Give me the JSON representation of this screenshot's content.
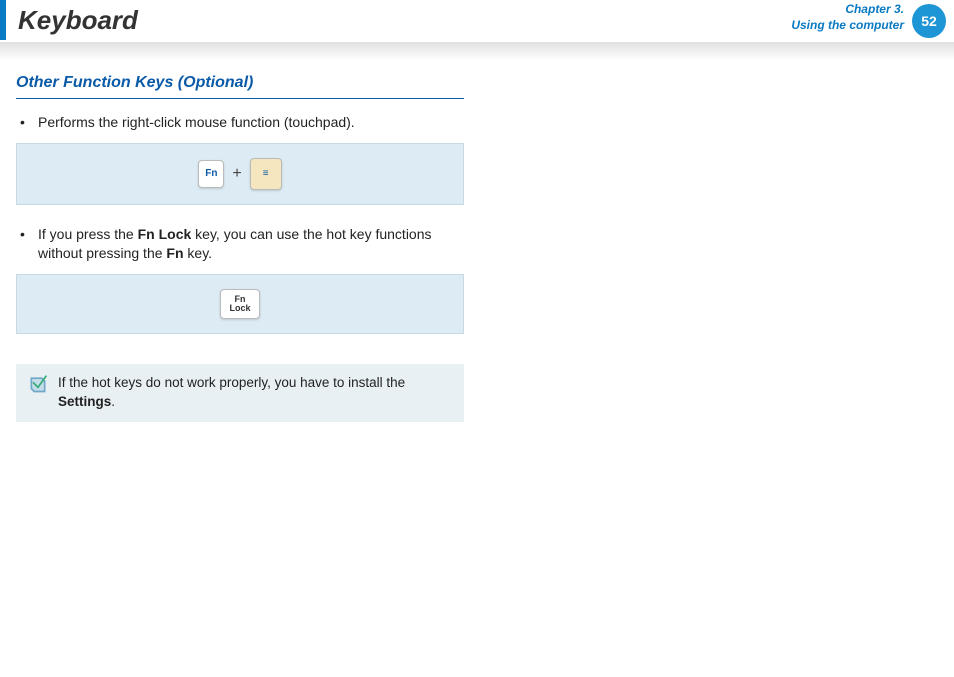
{
  "header": {
    "title": "Keyboard",
    "chapter_line1": "Chapter 3.",
    "chapter_line2": "Using the computer",
    "page_number": "52"
  },
  "section": {
    "heading": "Other Function Keys (Optional)",
    "bullet1": "Performs the right-click mouse function (touchpad).",
    "bullet2_pre": "If you press the ",
    "bullet2_b1": "Fn Lock",
    "bullet2_mid": " key, you can use the hot key functions without pressing the ",
    "bullet2_b2": "Fn",
    "bullet2_post": " key."
  },
  "keys": {
    "fn": "Fn",
    "plus": "+",
    "menu_glyph": "≡",
    "fnlock_l1": "Fn",
    "fnlock_l2": "Lock"
  },
  "note": {
    "text_pre": "If the hot keys do not work properly, you have to install the ",
    "text_bold": "Settings",
    "text_post": "."
  }
}
